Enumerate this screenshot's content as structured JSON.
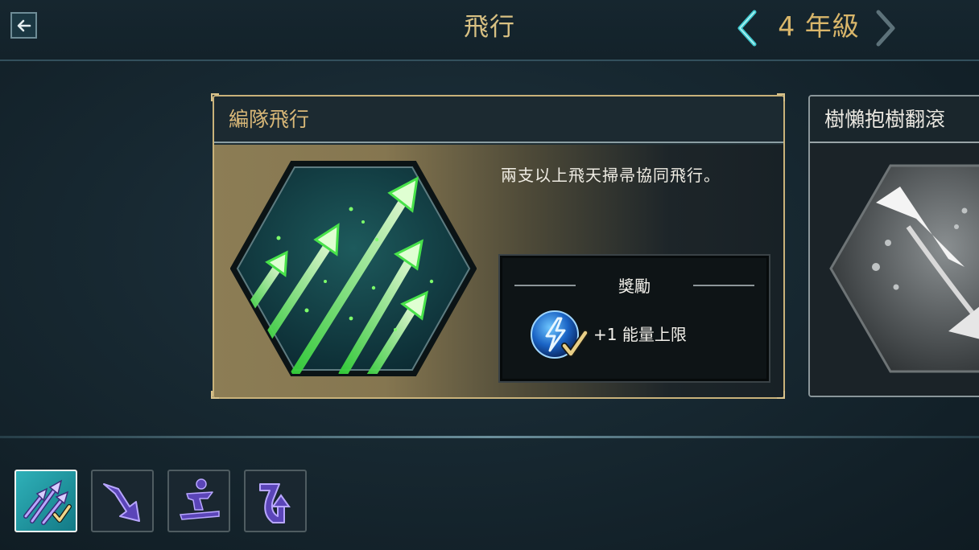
{
  "header": {
    "title": "飛行",
    "year_label": "4 年級",
    "back_icon": "arrow-left-icon",
    "prev_icon": "chevron-left-icon",
    "next_icon": "chevron-right-icon"
  },
  "cards": [
    {
      "title": "編隊飛行",
      "description": "兩支以上飛天掃帚協同飛行。",
      "icon": "formation-arrows-icon",
      "reward": {
        "title": "獎勵",
        "text": "+1 能量上限",
        "icon": "energy-bolt-check-icon"
      },
      "selected": true
    },
    {
      "title": "樹懶抱樹翻滾",
      "icon": "sloth-roll-icon",
      "selected": false
    }
  ],
  "tabs": [
    {
      "icon": "formation-arrows-check-icon",
      "selected": true,
      "completed": true
    },
    {
      "icon": "dive-arrow-icon",
      "selected": false
    },
    {
      "icon": "broom-rider-icon",
      "selected": false
    },
    {
      "icon": "hook-turn-arrow-icon",
      "selected": false
    }
  ],
  "colors": {
    "accent_gold": "#d9b66a",
    "accent_teal": "#2fb0b8",
    "glow_green": "#7dff6a"
  }
}
